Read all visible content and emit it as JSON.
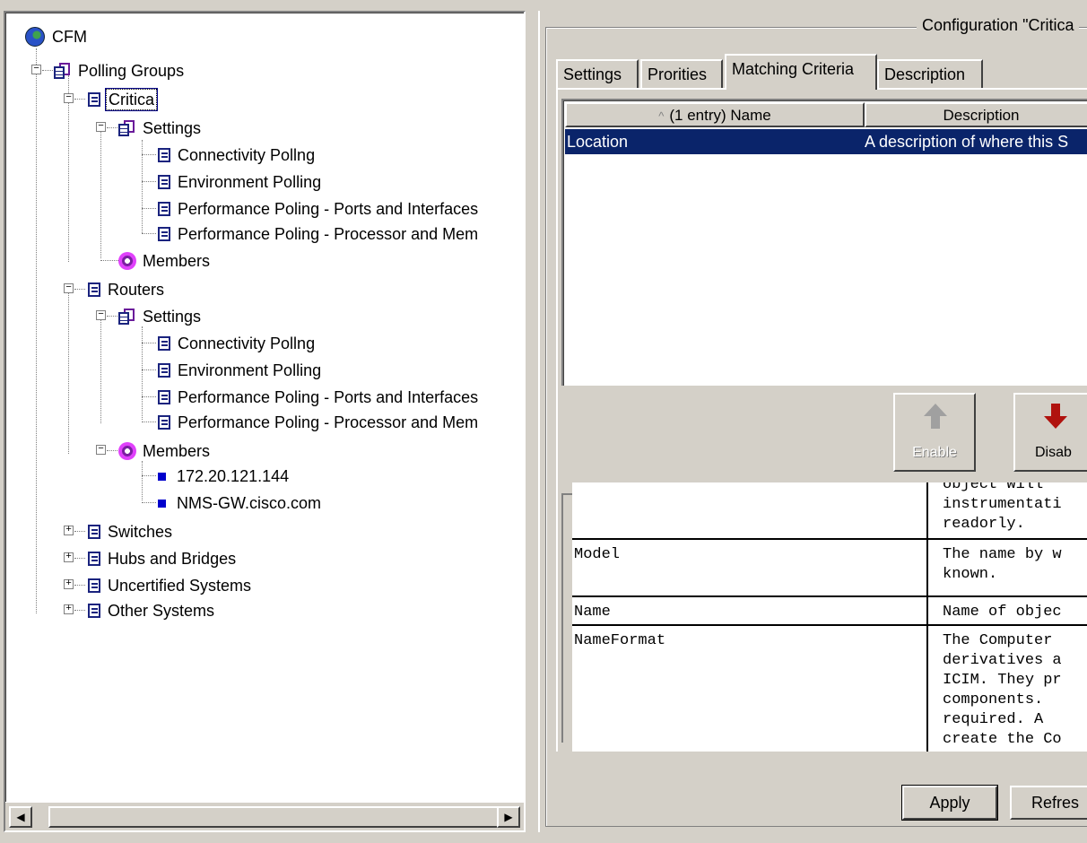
{
  "tree": {
    "root": "CFM",
    "polling_groups": "Polling Groups",
    "critical": {
      "label": "Critica",
      "settings": "Settings",
      "items": [
        "Connectivity Pollng",
        "Environment Polling",
        "Performance Poling - Ports and Interfaces",
        "Performance Poling - Processor and Mem"
      ],
      "members": "Members"
    },
    "routers": {
      "label": "Routers",
      "settings": "Settings",
      "items": [
        "Connectivity Pollng",
        "Environment Polling",
        "Performance Poling - Ports and Interfaces",
        "Performance Poling - Processor and Mem"
      ],
      "members": "Members",
      "member_items": [
        "172.20.121.144",
        "NMS-GW.cisco.com"
      ]
    },
    "others": [
      "Switches",
      "Hubs and Bridges",
      "Uncertified Systems",
      "Other Systems"
    ]
  },
  "config": {
    "title": "Configuration \"Critica",
    "tabs": [
      "Settings",
      "Prorities",
      "Matching Criteria",
      "Description"
    ],
    "active_tab": "Matching Criteria",
    "table": {
      "columns": [
        "(1 entry) Name",
        "Description"
      ],
      "sort_indicator": "^",
      "rows": [
        {
          "name": "Location",
          "description": "A description of where this S"
        }
      ]
    },
    "buttons": {
      "enable": "Enable",
      "disable": "Disab",
      "apply": "Apply",
      "refresh": "Refres"
    },
    "description_grid": {
      "rows": [
        {
          "name": "",
          "lines": [
            "object will ",
            "instrumentati",
            "readorly."
          ]
        },
        {
          "name": "Model",
          "lines": [
            "The name by w",
            "known."
          ]
        },
        {
          "name": "Name",
          "lines": [
            "Name of objec"
          ]
        },
        {
          "name": "NameFormat",
          "lines": [
            "The Computer",
            "derivatives a",
            "ICIM. They pr",
            "components. ",
            "required. A ",
            "create the Co"
          ]
        }
      ]
    }
  },
  "colors": {
    "selection": "#0a246a",
    "window": "#d4d0c8",
    "tree_doc": "#1a237e",
    "members_icon": "#e040fb",
    "disable_arrow": "#b0120e"
  },
  "icons": {
    "root": "globe-icon",
    "group": "documents-icon",
    "item": "document-icon",
    "members": "members-icon",
    "member": "square-icon"
  }
}
